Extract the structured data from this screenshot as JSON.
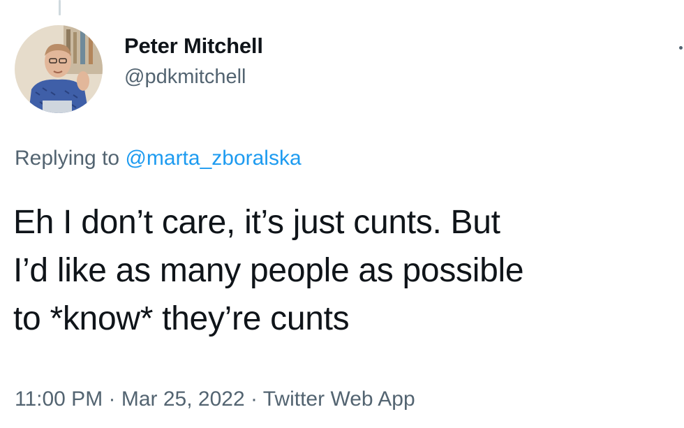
{
  "author": {
    "display_name": "Peter Mitchell",
    "handle": "@pdkmitchell",
    "avatar_icon": "user-photo-avatar"
  },
  "reply": {
    "prefix": "Replying to ",
    "mention": "@marta_zboralska"
  },
  "tweet": {
    "text_lines": [
      "Eh I don’t care, it’s just cunts. But",
      "I’d like as many people as possible",
      "to *know* they’re cunts"
    ]
  },
  "meta": {
    "time": "11:00 PM",
    "separator": " · ",
    "date": "Mar 25, 2022",
    "source": "Twitter Web App"
  },
  "colors": {
    "text_primary": "#0f1419",
    "text_secondary": "#536471",
    "link": "#1d9bf0"
  }
}
